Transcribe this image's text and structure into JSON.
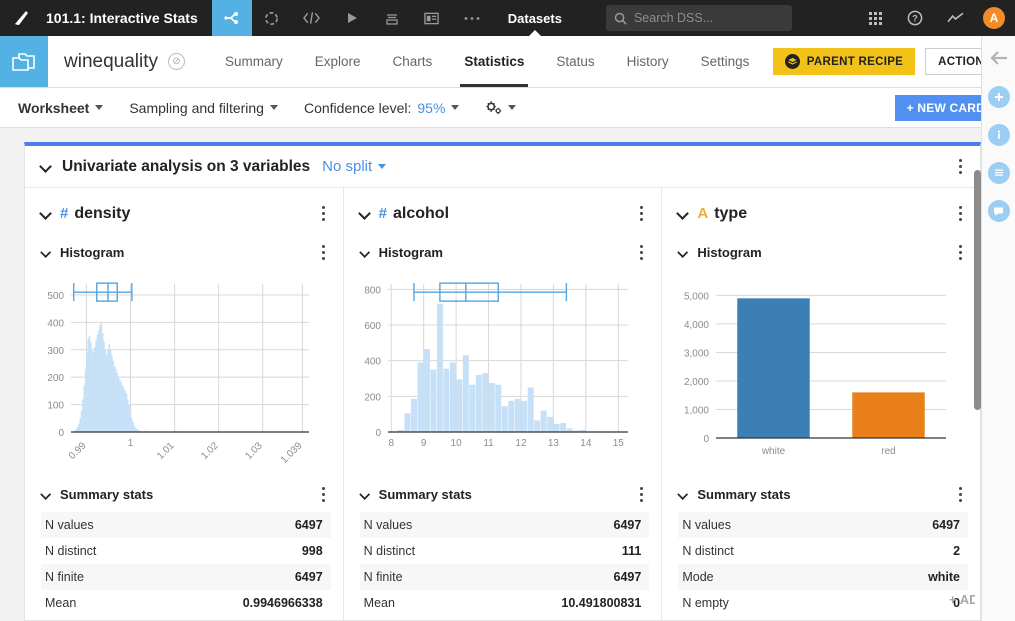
{
  "topbar": {
    "project_title": "101.1: Interactive Stats",
    "logo_icon": "dataiku-logo-icon",
    "icons": [
      {
        "name": "flow-icon",
        "glyph": "➤",
        "active": true
      },
      {
        "name": "jobs-icon",
        "glyph": "◌",
        "active": false
      },
      {
        "name": "code-icon",
        "glyph": "</>",
        "active": false
      },
      {
        "name": "run-icon",
        "glyph": "▶",
        "active": false
      },
      {
        "name": "automation-icon",
        "glyph": "⌸",
        "active": false
      },
      {
        "name": "dashboard-icon",
        "glyph": "▤",
        "active": false
      },
      {
        "name": "more-icon",
        "glyph": "⋯",
        "active": false
      }
    ],
    "nav_label": "Datasets",
    "search_placeholder": "Search DSS...",
    "apps_icon": "apps-grid-icon",
    "help_icon": "help-icon",
    "activity_icon": "activity-trend-icon",
    "avatar_initial": "A"
  },
  "navbar": {
    "dataset_icon": "dataset-folder-icon",
    "dataset_name": "winequality",
    "status_badge_glyph": "⊘",
    "tabs": [
      {
        "label": "Summary",
        "active": false
      },
      {
        "label": "Explore",
        "active": false
      },
      {
        "label": "Charts",
        "active": false
      },
      {
        "label": "Statistics",
        "active": true
      },
      {
        "label": "Status",
        "active": false
      },
      {
        "label": "History",
        "active": false
      },
      {
        "label": "Settings",
        "active": false
      }
    ],
    "parent_recipe_label": "PARENT RECIPE",
    "parent_recipe_icon": "recipe-stack-icon",
    "actions_label": "ACTIONS",
    "collapse_icon": "arrow-left-icon"
  },
  "toolbar": {
    "worksheet_label": "Worksheet",
    "sampling_label": "Sampling and filtering",
    "confidence_prefix": "Confidence level:",
    "confidence_value": "95%",
    "settings_icon": "gears-icon",
    "new_card_label": "+ NEW CARD"
  },
  "card": {
    "title": "Univariate analysis on 3 variables",
    "split_label": "No split",
    "menu_icon": "kebab-menu-icon"
  },
  "columns": [
    {
      "name": "density",
      "type_glyph": "#",
      "type_class": "num",
      "histogram_label": "Histogram",
      "summary_label": "Summary stats",
      "stats": [
        {
          "label": "N values",
          "value": "6497"
        },
        {
          "label": "N distinct",
          "value": "998"
        },
        {
          "label": "N finite",
          "value": "6497"
        },
        {
          "label": "Mean",
          "value": "0.9946966338"
        }
      ]
    },
    {
      "name": "alcohol",
      "type_glyph": "#",
      "type_class": "num",
      "histogram_label": "Histogram",
      "summary_label": "Summary stats",
      "stats": [
        {
          "label": "N values",
          "value": "6497"
        },
        {
          "label": "N distinct",
          "value": "111"
        },
        {
          "label": "N finite",
          "value": "6497"
        },
        {
          "label": "Mean",
          "value": "10.491800831"
        }
      ]
    },
    {
      "name": "type",
      "type_glyph": "A",
      "type_class": "str",
      "histogram_label": "Histogram",
      "summary_label": "Summary stats",
      "stats": [
        {
          "label": "N values",
          "value": "6497"
        },
        {
          "label": "N distinct",
          "value": "2"
        },
        {
          "label": "Mode",
          "value": "white"
        },
        {
          "label": "N empty",
          "value": "0"
        }
      ]
    }
  ],
  "chart_data": [
    {
      "type": "bar",
      "title": "density histogram",
      "xlabel": "",
      "ylabel": "",
      "xticks": [
        "0.99",
        "1",
        "1.01",
        "1.02",
        "1.03",
        "1.039"
      ],
      "xtick_values": [
        0.99,
        1.0,
        1.01,
        1.02,
        1.03,
        1.039
      ],
      "yticks": [
        0,
        100,
        200,
        300,
        400,
        500
      ],
      "ylim": [
        0,
        540
      ],
      "xlim": [
        0.9865,
        1.0405
      ],
      "grid": true,
      "bar_color": "#c5e0f7",
      "x": [
        0.9871,
        0.9874,
        0.9877,
        0.988,
        0.9883,
        0.9886,
        0.9889,
        0.9892,
        0.9895,
        0.9898,
        0.9901,
        0.9904,
        0.9907,
        0.991,
        0.9913,
        0.9916,
        0.9919,
        0.9922,
        0.9925,
        0.9928,
        0.9931,
        0.9934,
        0.9937,
        0.994,
        0.9943,
        0.9946,
        0.9949,
        0.9952,
        0.9955,
        0.9958,
        0.9961,
        0.9964,
        0.9967,
        0.997,
        0.9973,
        0.9976,
        0.9979,
        0.9982,
        0.9985,
        0.9988,
        0.9991,
        0.9994,
        0.9997,
        1.0,
        1.0003,
        1.0006,
        1.0009,
        1.0012,
        1.0015,
        1.0018,
        1.0021,
        1.0024,
        1.0035,
        1.0103,
        1.039
      ],
      "values": [
        2,
        5,
        10,
        18,
        30,
        52,
        78,
        120,
        170,
        230,
        290,
        340,
        352,
        330,
        300,
        290,
        310,
        335,
        355,
        370,
        390,
        398,
        360,
        330,
        300,
        280,
        300,
        320,
        300,
        280,
        260,
        240,
        230,
        215,
        200,
        190,
        180,
        170,
        160,
        150,
        140,
        120,
        100,
        75,
        50,
        35,
        22,
        14,
        10,
        6,
        4,
        3,
        5,
        3,
        2
      ],
      "boxplot": {
        "min": 0.98711,
        "q1": 0.99234,
        "median": 0.99489,
        "q3": 0.99699,
        "max": 1.00032
      }
    },
    {
      "type": "bar",
      "title": "alcohol histogram",
      "xlabel": "",
      "ylabel": "",
      "xticks": [
        "8",
        "9",
        "10",
        "11",
        "12",
        "13",
        "14",
        "15"
      ],
      "xtick_values": [
        8,
        9,
        10,
        11,
        12,
        13,
        14,
        15
      ],
      "yticks": [
        0,
        200,
        400,
        600,
        800
      ],
      "ylim": [
        0,
        830
      ],
      "xlim": [
        7.9,
        15.3
      ],
      "grid": true,
      "bar_color": "#c5e0f7",
      "x": [
        8.1,
        8.3,
        8.5,
        8.7,
        8.9,
        9.1,
        9.3,
        9.5,
        9.7,
        9.9,
        10.1,
        10.3,
        10.5,
        10.7,
        10.9,
        11.1,
        11.3,
        11.5,
        11.7,
        11.9,
        12.1,
        12.3,
        12.5,
        12.7,
        12.9,
        13.1,
        13.3,
        13.5,
        13.7,
        13.9,
        14.1,
        14.3
      ],
      "values": [
        2,
        12,
        105,
        185,
        390,
        465,
        350,
        720,
        355,
        390,
        295,
        430,
        265,
        320,
        330,
        275,
        265,
        145,
        175,
        185,
        175,
        250,
        65,
        120,
        85,
        45,
        50,
        20,
        8,
        12,
        4,
        2
      ],
      "boxplot": {
        "min": 8.7,
        "q1": 9.5,
        "median": 10.3,
        "q3": 11.3,
        "max": 13.4
      }
    },
    {
      "type": "bar",
      "title": "type histogram",
      "xlabel": "",
      "ylabel": "",
      "categories": [
        "white",
        "red"
      ],
      "values": [
        4898,
        1599
      ],
      "colors": [
        "#3b7fb5",
        "#e98019"
      ],
      "yticks": [
        0,
        1000,
        2000,
        3000,
        4000,
        5000
      ],
      "ytick_labels": [
        "0",
        "1,000",
        "2,000",
        "3,000",
        "4,000",
        "5,000"
      ],
      "ylim": [
        0,
        5400
      ],
      "grid": true
    }
  ],
  "rail": {
    "items": [
      {
        "name": "collapse-arrow-icon",
        "glyph": "←",
        "circle": false
      },
      {
        "name": "add-icon",
        "glyph": "+",
        "circle": true
      },
      {
        "name": "info-icon",
        "glyph": "i",
        "circle": true
      },
      {
        "name": "details-icon",
        "glyph": "☰",
        "circle": true
      },
      {
        "name": "discussions-icon",
        "glyph": "●",
        "circle": true
      }
    ],
    "add_card_ghost": "+ ADD CARD"
  }
}
